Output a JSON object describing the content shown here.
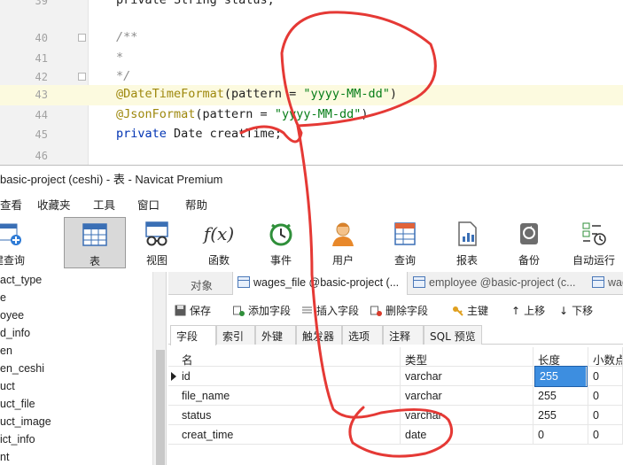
{
  "editor": {
    "lines": [
      {
        "num": "39",
        "text": "private String status;"
      },
      {
        "num": "40",
        "text": "/**"
      },
      {
        "num": "41",
        "text": "*"
      },
      {
        "num": "42",
        "text": "*/"
      },
      {
        "num": "43",
        "ann": "@DateTimeFormat",
        "mid": "(pattern = ",
        "str": "\"yyyy-MM-dd\"",
        "end": ")"
      },
      {
        "num": "44",
        "ann": "@JsonFormat",
        "mid": "(pattern = ",
        "str": "\"yyyy-MM-dd\"",
        "end": ")"
      },
      {
        "num": "45",
        "kw": "private",
        "rest": " Date creatTime;"
      },
      {
        "num": "46",
        "text": ""
      }
    ]
  },
  "window": {
    "title": "basic-project (ceshi) - 表 - Navicat Premium"
  },
  "menu": [
    "查看",
    "收藏夹",
    "工具",
    "窗口",
    "帮助"
  ],
  "toolbar": {
    "items": [
      {
        "label": "建查询",
        "icon": "new-query-icon"
      },
      {
        "label": "表",
        "icon": "table-icon"
      },
      {
        "label": "视图",
        "icon": "view-icon"
      },
      {
        "label": "函数",
        "icon": "function-icon"
      },
      {
        "label": "事件",
        "icon": "event-clock-icon"
      },
      {
        "label": "用户",
        "icon": "user-icon"
      },
      {
        "label": "查询",
        "icon": "query-icon"
      },
      {
        "label": "报表",
        "icon": "report-icon"
      },
      {
        "label": "备份",
        "icon": "backup-icon"
      },
      {
        "label": "自动运行",
        "icon": "automation-icon"
      }
    ],
    "fx_glyph": "f(x)"
  },
  "tree": {
    "items": [
      "act_type",
      "e",
      "oyee",
      "d_info",
      "en",
      "en_ceshi",
      "uct",
      "uct_file",
      "uct_image",
      "ict_info",
      "nt"
    ]
  },
  "tabs": {
    "objects_label": "对象",
    "items": [
      {
        "label": "wages_file @basic-project (..."
      },
      {
        "label": "employee @basic-project (c..."
      },
      {
        "label": "wag"
      }
    ]
  },
  "designer": {
    "save": "保存",
    "add_field": "添加字段",
    "insert_field": "插入字段",
    "delete_field": "删除字段",
    "primary_key": "主键",
    "move_up": "上移",
    "move_down": "下移"
  },
  "subtabs": [
    "字段",
    "索引",
    "外键",
    "触发器",
    "选项",
    "注释",
    "SQL 预览"
  ],
  "grid": {
    "headers": {
      "name": "名",
      "type": "类型",
      "length": "长度",
      "decimals": "小数点"
    },
    "rows": [
      {
        "name": "id",
        "type": "varchar",
        "length": "255",
        "decimals": "0"
      },
      {
        "name": "file_name",
        "type": "varchar",
        "length": "255",
        "decimals": "0"
      },
      {
        "name": "status",
        "type": "varchar",
        "length": "255",
        "decimals": "0"
      },
      {
        "name": "creat_time",
        "type": "date",
        "length": "0",
        "decimals": "0"
      }
    ]
  },
  "colors": {
    "annotation_stroke": "#e53935",
    "selection": "#3d8ee0"
  }
}
